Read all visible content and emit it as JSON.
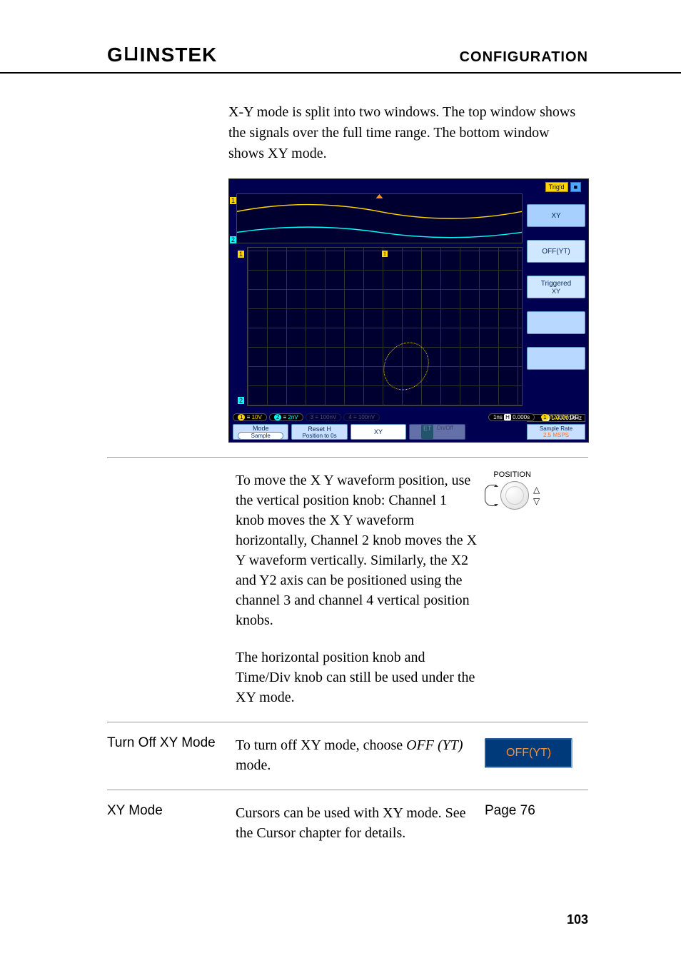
{
  "header": {
    "logo": "GWINSTEK",
    "section": "CONFIGURATION"
  },
  "intro_paragraph": "X-Y mode is split into two windows. The top window shows the signals over the full time range. The bottom window shows XY mode.",
  "scope": {
    "top_status": {
      "trigd": "Trig'd",
      "stop_icon": "■"
    },
    "side_buttons": {
      "xy": "XY",
      "off_yt": "OFF(YT)",
      "triggered": "Triggered",
      "triggered_sub": "XY"
    },
    "channels": {
      "ch1": {
        "num": "1",
        "scale": "10V"
      },
      "ch2": {
        "num": "2",
        "scale": "2nV"
      },
      "ch3_faded": "100nV",
      "ch4_faded": "100nV"
    },
    "timebase": {
      "scale": "1ns",
      "pos_icon": "H",
      "pos": "0.000s"
    },
    "trigger": {
      "num": "1",
      "edge_icon": "f",
      "level": "22.0V",
      "coupling": "DC"
    },
    "freq": {
      "probe": "P",
      "value": "1.00001kHz"
    },
    "markers": {
      "ch1": "1",
      "ch2": "2",
      "ch1x": "1",
      "ch2x": "2"
    },
    "softkeys": {
      "mode": "Mode",
      "mode_sub": "Sample",
      "reset": "Reset H",
      "reset_sub": "Position to 0s",
      "xy": "XY",
      "et": "ET",
      "et_sub": "On/Off"
    },
    "sample_rate_label": "Sample Rate",
    "sample_rate_value": "2.5 MSPS"
  },
  "move_paragraph": "To move the X Y waveform position, use the vertical position knob: Channel 1 knob moves the X Y waveform horizontally, Channel 2 knob moves the X Y waveform vertically. Similarly, the X2 and Y2 axis can be positioned using the channel 3 and channel 4 vertical position knobs.",
  "horiz_paragraph": "The horizontal position knob and Time/Div knob can still be used under the XY mode.",
  "knob": {
    "label": "POSITION",
    "up": "△",
    "down": "▽"
  },
  "turn_off_row": {
    "left": "Turn Off XY Mode",
    "mid_pre": "To turn off XY mode, choose ",
    "mid_em": "OFF (YT)",
    "mid_post": " mode.",
    "button": "OFF(YT)"
  },
  "cursor_row": {
    "left": "XY Mode",
    "mid": "Cursors can be used with XY mode. See the Cursor chapter for details.",
    "right": "Page 76"
  },
  "page_number": "103"
}
